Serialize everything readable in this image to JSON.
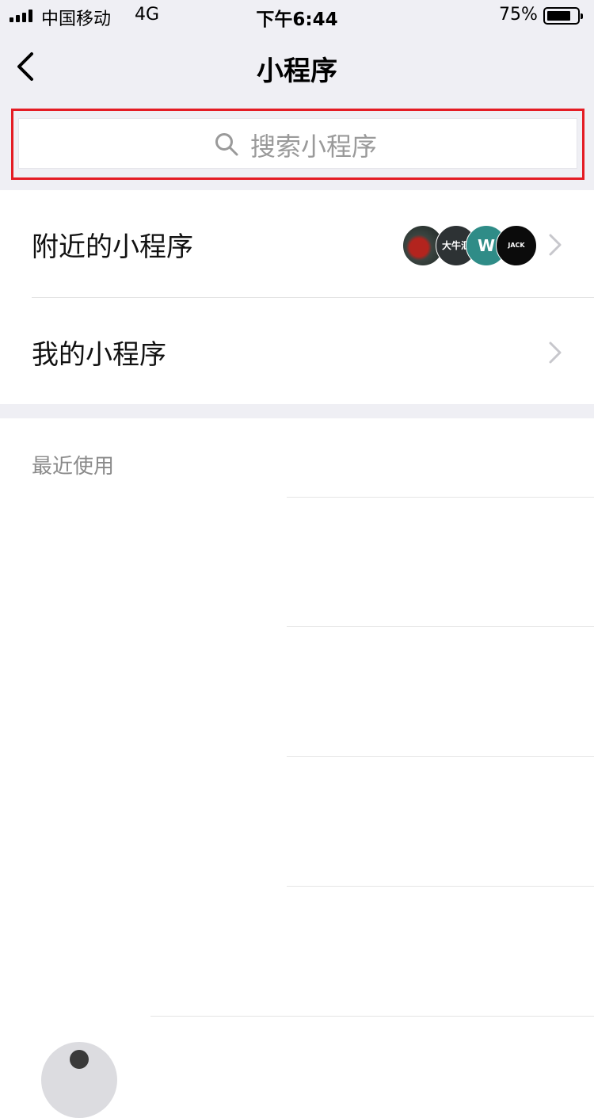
{
  "status_bar": {
    "carrier": "中国移动",
    "network": "4G",
    "time": "下午6:44",
    "battery_percent": "75%",
    "battery_level": 0.75
  },
  "nav": {
    "title": "小程序",
    "back_icon": "chevron-left-icon"
  },
  "search": {
    "placeholder": "搜索小程序",
    "icon": "search-icon",
    "highlight_color": "#e41c24"
  },
  "menu": {
    "nearby_label": "附近的小程序",
    "mine_label": "我的小程序",
    "nearby_avatars": [
      {
        "name": "car-app-avatar",
        "text": ""
      },
      {
        "name": "daniu-app-avatar",
        "text": "大牛汇"
      },
      {
        "name": "w-app-avatar",
        "text": "W"
      },
      {
        "name": "jackjones-app-avatar",
        "text": "JACK JONES"
      }
    ]
  },
  "recent": {
    "header": "最近使用"
  },
  "colors": {
    "page_bg": "#efeff4",
    "highlight": "#e41c24",
    "muted_text": "#8a8a8a"
  }
}
